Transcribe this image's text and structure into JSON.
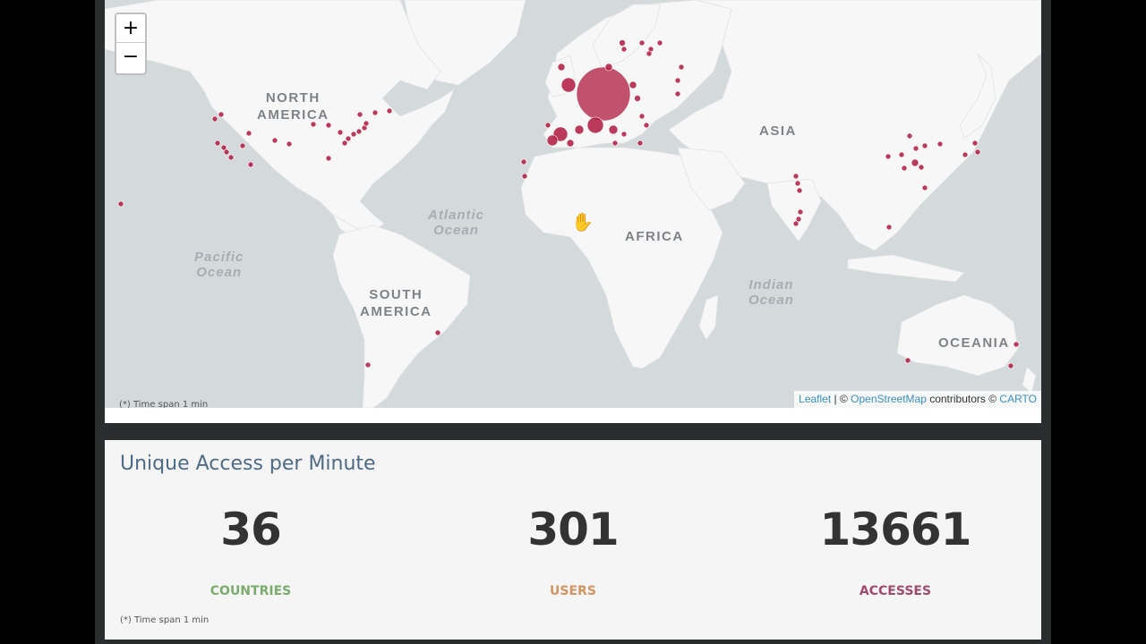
{
  "map": {
    "zoom_in": "+",
    "zoom_out": "−",
    "continents": [
      "NORTH\nAMERICA",
      "SOUTH\nAMERICA",
      "AFRICA",
      "ASIA",
      "OCEANIA"
    ],
    "oceans": [
      "Atlantic\nOcean",
      "Pacific\nOcean",
      "Indian\nOcean"
    ],
    "time_span_note": "(*) Time span 1 min",
    "attribution": {
      "leaflet": "Leaflet",
      "sep": " | © ",
      "osm": "OpenStreetMap",
      "contributors": " contributors © ",
      "carto": "CARTO"
    },
    "marker_color": "#b0193f",
    "cursor_icon": "hand-grab-icon"
  },
  "stats": {
    "title": "Unique Access per Minute",
    "countries": {
      "value": "36",
      "label": "COUNTRIES",
      "color": "#7aac6e"
    },
    "users": {
      "value": "301",
      "label": "USERS",
      "color": "#d49461"
    },
    "accesses": {
      "value": "13661",
      "label": "ACCESSES",
      "color": "#a04a6c"
    },
    "time_span_note": "(*) Time span 1 min"
  }
}
